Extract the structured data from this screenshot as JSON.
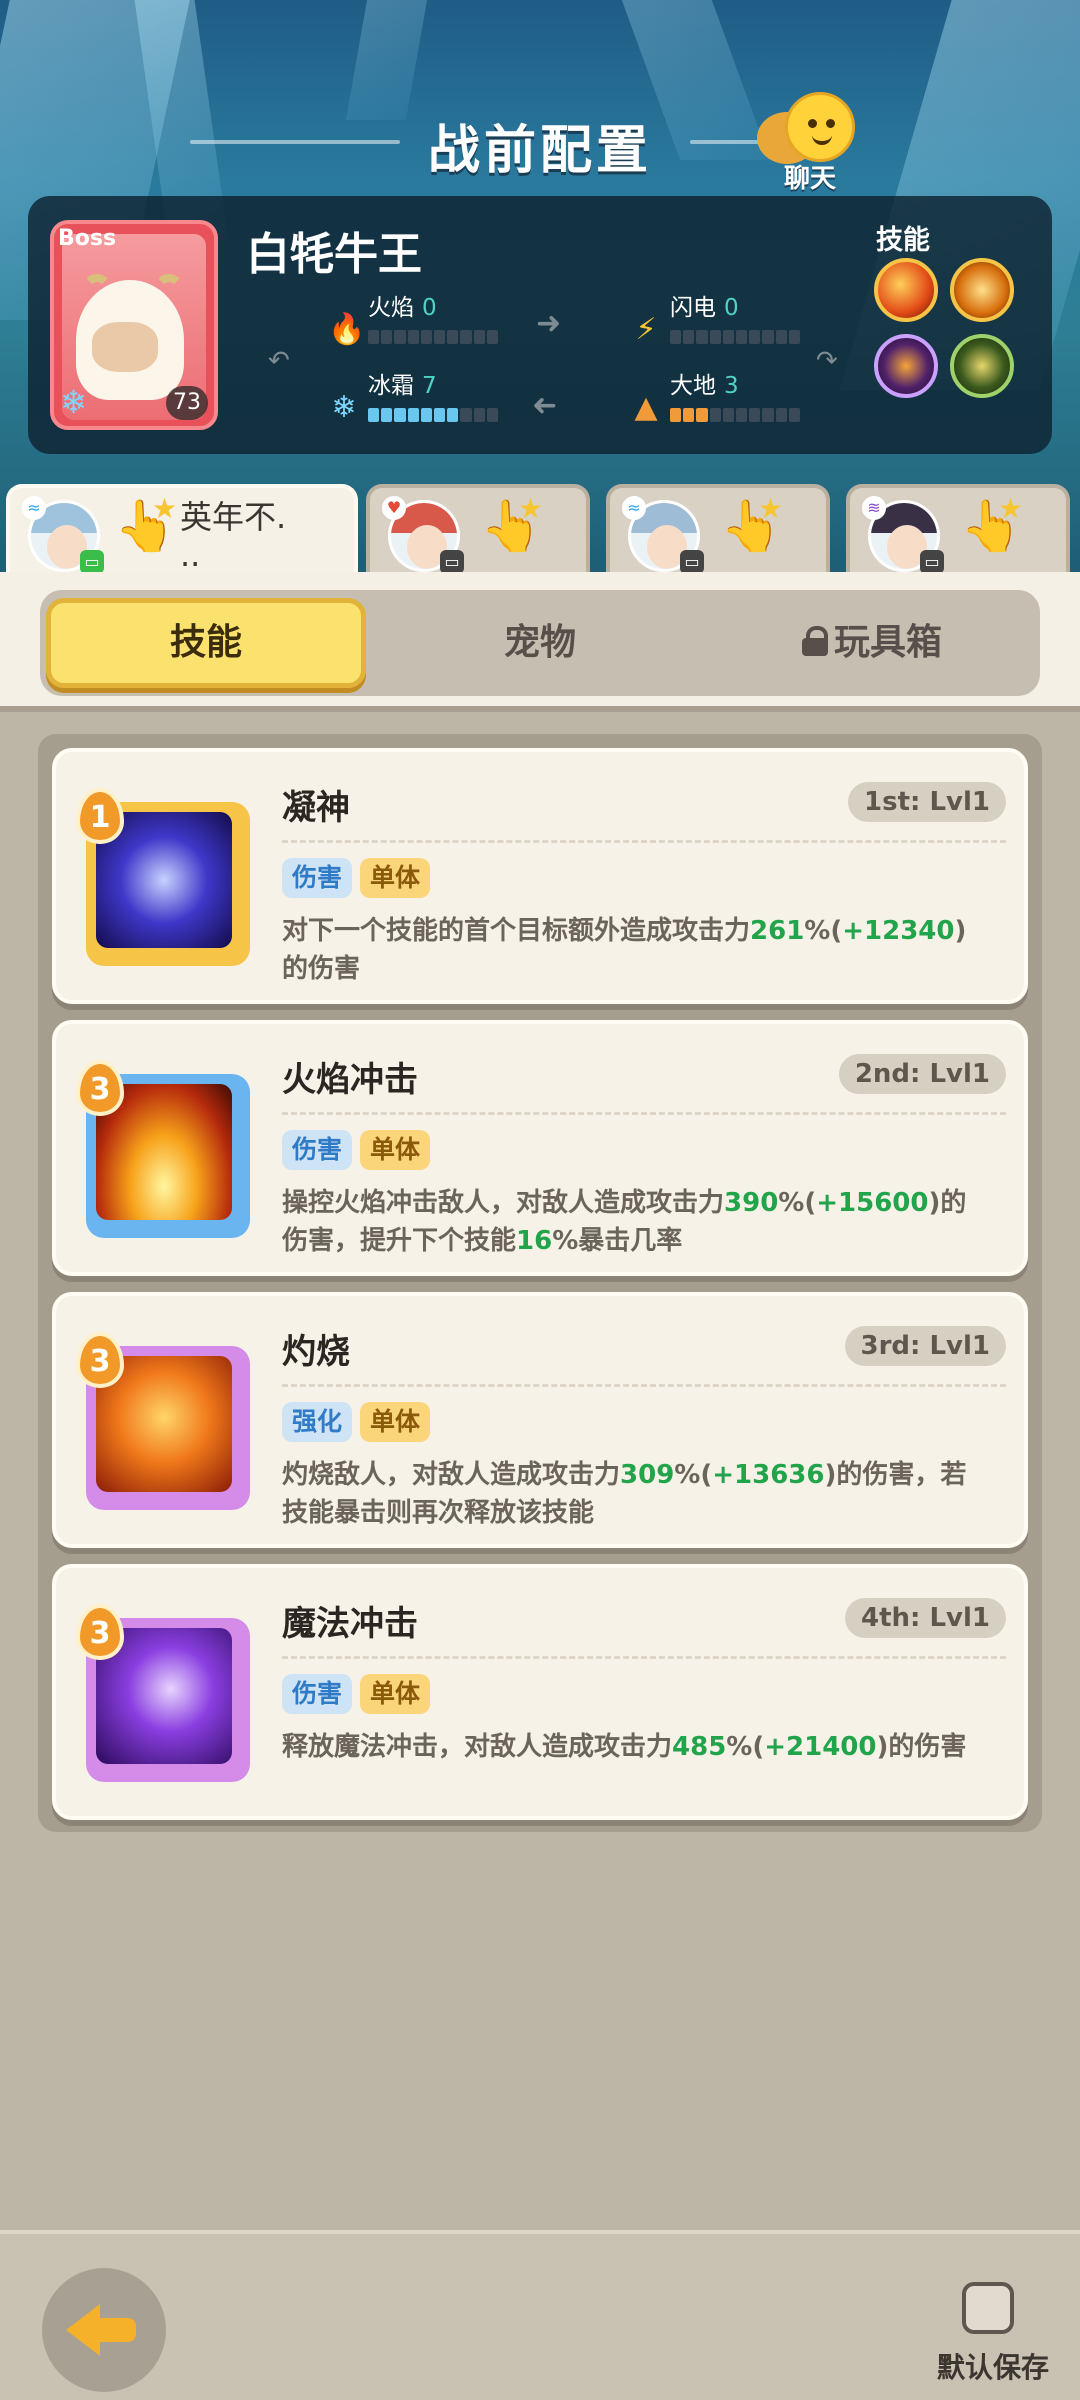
{
  "header": {
    "title": "战前配置",
    "chat_label": "聊天"
  },
  "boss": {
    "tag": "Boss",
    "name": "白牦牛王",
    "level": "73",
    "elements": {
      "fire": {
        "label": "火焰",
        "value": "0",
        "level": 0
      },
      "lightning": {
        "label": "闪电",
        "value": "0",
        "level": 0
      },
      "frost": {
        "label": "冰霜",
        "value": "7",
        "level": 7
      },
      "earth": {
        "label": "大地",
        "value": "3",
        "level": 3
      }
    },
    "skills_label": "技能",
    "skill_icons": [
      "fire-burst-icon",
      "flame-slash-icon",
      "dark-face-icon",
      "earth-beast-icon"
    ]
  },
  "hero_tabs": [
    {
      "name": "英年不.\n..",
      "active": true
    },
    {
      "name": "",
      "active": false
    },
    {
      "name": "",
      "active": false
    },
    {
      "name": "",
      "active": false
    }
  ],
  "segments": {
    "skills": "技能",
    "pets": "宠物",
    "toybox": "玩具箱"
  },
  "skills": [
    {
      "name": "凝神",
      "slot": "1st: Lvl1",
      "cost": "1",
      "tags": [
        "伤害",
        "单体"
      ],
      "desc_pre": "对下一个技能的首个目标额外造成攻击力",
      "pct": "261",
      "mid": "%(",
      "bonus": "+12340",
      "desc_post": ")的伤害"
    },
    {
      "name": "火焰冲击",
      "slot": "2nd: Lvl1",
      "cost": "3",
      "tags": [
        "伤害",
        "单体"
      ],
      "desc_pre": "操控火焰冲击敌人，对敌人造成攻击力",
      "pct": "390",
      "mid": "%(",
      "bonus": "+15600",
      "desc_post": ")的伤害，提升下个技能",
      "pct2": "16",
      "desc_tail": "%暴击几率"
    },
    {
      "name": "灼烧",
      "slot": "3rd: Lvl1",
      "cost": "3",
      "tags": [
        "强化",
        "单体"
      ],
      "desc_pre": "灼烧敌人，对敌人造成攻击力",
      "pct": "309",
      "mid": "%(",
      "bonus": "+13636",
      "desc_post": ")的伤害，若技能暴击则再次释放该技能"
    },
    {
      "name": "魔法冲击",
      "slot": "4th: Lvl1",
      "cost": "3",
      "tags": [
        "伤害",
        "单体"
      ],
      "desc_pre": "释放魔法冲击，对敌人造成攻击力",
      "pct": "485",
      "mid": "%(",
      "bonus": "+21400",
      "desc_post": ")的伤害"
    }
  ],
  "footer": {
    "save_label": "默认保存"
  }
}
